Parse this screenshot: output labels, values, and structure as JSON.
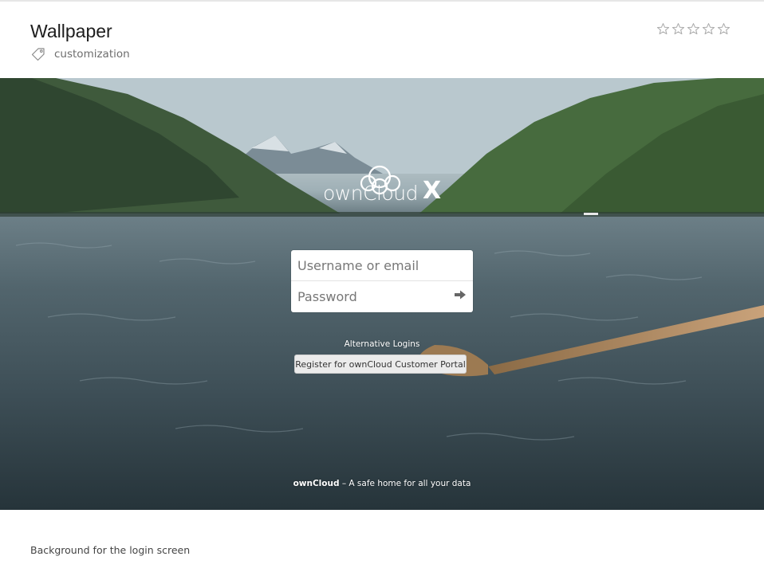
{
  "app": {
    "title": "Wallpaper",
    "tag": "customization",
    "tag_icon": "tag-icon",
    "rating": {
      "value": 0,
      "max": 5,
      "icon": "star-outline-icon",
      "color": "#b0b0b0"
    }
  },
  "preview": {
    "brand": "ownCloud",
    "brand_suffix": "X",
    "username_placeholder": "Username or email",
    "password_placeholder": "Password",
    "submit_icon": "arrow-right-icon",
    "alternative_logins_label": "Alternative Logins",
    "register_label": "Register for ownCloud Customer Portal",
    "footer_brand": "ownCloud",
    "footer_tagline": " – A safe home for all your data"
  },
  "description": "Background for the login screen"
}
